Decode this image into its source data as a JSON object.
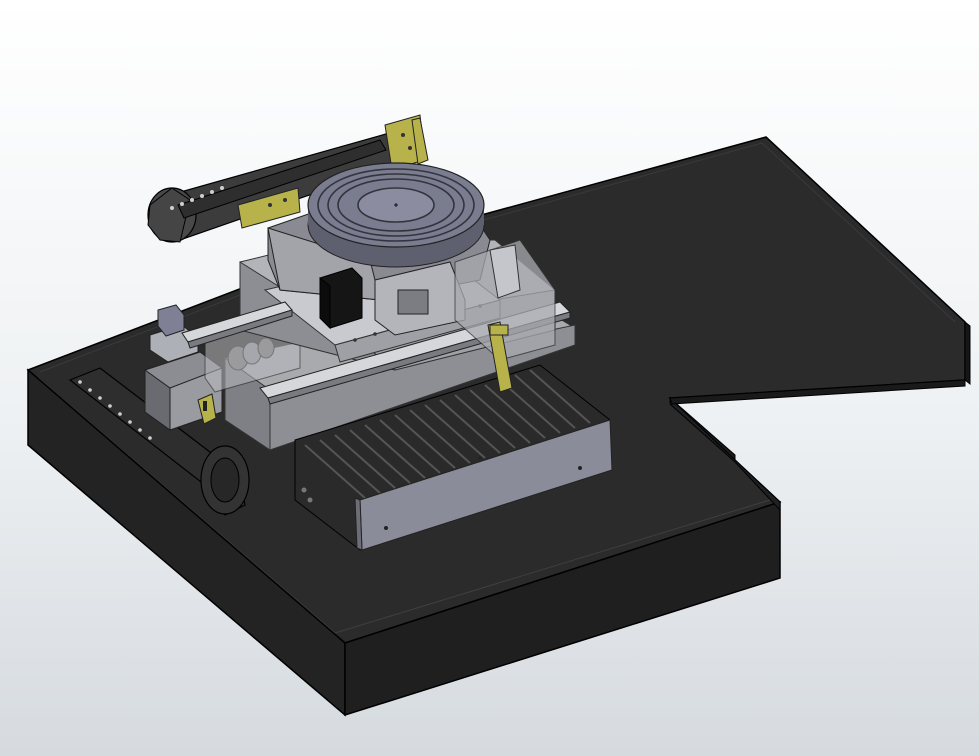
{
  "viewport": {
    "background": "gradient-white-to-grey",
    "render_style": "shaded-with-edges"
  },
  "colors": {
    "table_top": "#2b2b2b",
    "table_side": "#1d1d1d",
    "table_edge": "#000000",
    "steel_light": "#c7c8cc",
    "steel_mid": "#9d9ea3",
    "steel_dark": "#6e6f74",
    "rotary_disc": "#74768a",
    "rotary_disc_light": "#9697ab",
    "bracket_yellow": "#b7b24a",
    "arm_dark": "#444444",
    "bellows_dark": "#2a2a2a",
    "motor_black": "#151515"
  },
  "model": {
    "components": [
      "machine-table-base",
      "rotary-table",
      "swing-arm",
      "xy-stage-carriage",
      "linear-guide-rails",
      "bellows-cover",
      "servo-motor",
      "cable-chain",
      "mounting-brackets"
    ]
  }
}
